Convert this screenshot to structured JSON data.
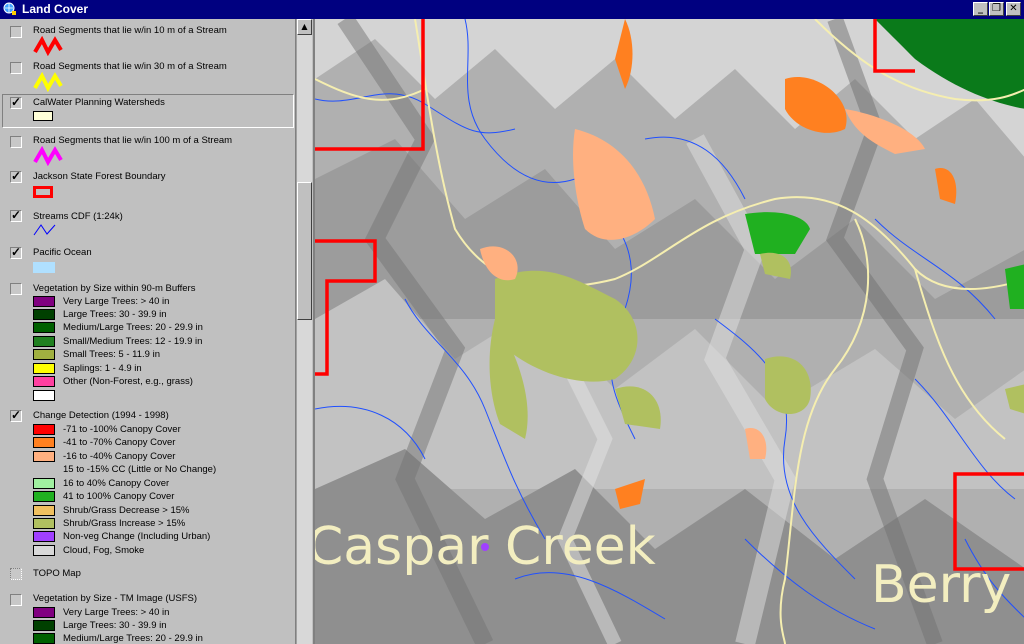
{
  "window": {
    "title": "Land Cover",
    "buttons": [
      "_",
      "❐",
      "✕"
    ]
  },
  "legend": {
    "layers": [
      {
        "label": "Road Segments that lie w/in 10 m of a Stream",
        "checked": false,
        "symbol": "zigzag",
        "color": "#ff0000"
      },
      {
        "label": "Road Segments that lie w/in 30 m of a Stream",
        "checked": false,
        "symbol": "zigzag",
        "color": "#ffff00"
      },
      {
        "label": "CalWater Planning Watersheds",
        "checked": true,
        "symbol": "rect-outline",
        "color": "#ffffc0"
      },
      {
        "label": "Road Segments that lie w/in 100 m of a Stream",
        "checked": false,
        "symbol": "zigzag",
        "color": "#ff00ff"
      },
      {
        "label": "Jackson State Forest Boundary",
        "checked": true,
        "symbol": "rect-thick",
        "color": "#ff0000"
      },
      {
        "label": "Streams CDF (1:24k)",
        "checked": true,
        "symbol": "line",
        "color": "#0000ff"
      },
      {
        "label": "Pacific Ocean",
        "checked": true,
        "symbol": "fill",
        "color": "#b0e0ff"
      }
    ],
    "vegetation": {
      "label": "Vegetation by Size within 90-m Buffers",
      "checked": false,
      "items": [
        {
          "label": "Very Large Trees: > 40  in",
          "color": "#800080"
        },
        {
          "label": "Large Trees: 30 - 39.9 in",
          "color": "#004000"
        },
        {
          "label": "Medium/Large Trees: 20 - 29.9 in",
          "color": "#006000"
        },
        {
          "label": "Small/Medium Trees: 12 - 19.9 in",
          "color": "#208020"
        },
        {
          "label": "Small Trees: 5 - 11.9 in",
          "color": "#a0b040"
        },
        {
          "label": "Saplings: 1 - 4.9 in",
          "color": "#ffff00"
        },
        {
          "label": "Other (Non-Forest, e.g., grass)",
          "color": "#ff40a0"
        },
        {
          "label": "",
          "color": "#ffffff"
        }
      ]
    },
    "change": {
      "label": "Change Detection (1994 - 1998)",
      "checked": true,
      "items": [
        {
          "label": "-71 to -100% Canopy Cover",
          "color": "#ff0000"
        },
        {
          "label": "-41 to -70% Canopy Cover",
          "color": "#ff8020"
        },
        {
          "label": "-16 to -40% Canopy Cover",
          "color": "#ffb080"
        },
        {
          "label": "15 to -15% CC (Little or No Change)",
          "color": ""
        },
        {
          "label": "16 to 40% Canopy Cover",
          "color": "#a0f0a0"
        },
        {
          "label": "41 to 100% Canopy Cover",
          "color": "#20b020"
        },
        {
          "label": "Shrub/Grass Decrease > 15%",
          "color": "#f0c060"
        },
        {
          "label": "Shrub/Grass Increase > 15%",
          "color": "#b0c060"
        },
        {
          "label": "Non-veg Change (Including Urban)",
          "color": "#a040ff"
        },
        {
          "label": "Cloud, Fog, Smoke",
          "color": "#d8d8d8"
        }
      ]
    },
    "topo": {
      "label": "TOPO Map",
      "checked": false
    },
    "vegetation_tm": {
      "label": "Vegetation by Size - TM Image (USFS)",
      "checked": false,
      "items": [
        {
          "label": "Very Large Trees: > 40  in",
          "color": "#800080"
        },
        {
          "label": "Large Trees: 30 - 39.9 in",
          "color": "#004000"
        },
        {
          "label": "Medium/Large Trees: 20 - 29.9 in",
          "color": "#006000"
        }
      ]
    }
  },
  "map": {
    "labels": {
      "caspar": "Caspar Creek",
      "berry": "Berry"
    }
  }
}
